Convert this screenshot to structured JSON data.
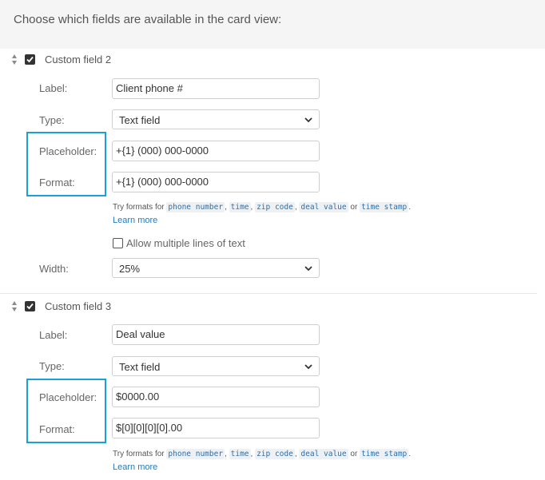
{
  "header": {
    "text": "Choose which fields are available in the card view:"
  },
  "fields": [
    {
      "title": "Custom field 2",
      "checked": true,
      "label_caption": "Label:",
      "label_value": "Client phone #",
      "type_caption": "Type:",
      "type_value": "Text field",
      "placeholder_caption": "Placeholder:",
      "placeholder_value": "+{1} (000) 000-0000",
      "format_caption": "Format:",
      "format_value": "+{1} (000) 000-0000",
      "hint": {
        "prefix": "Try formats for ",
        "formats": [
          "phone number",
          "time",
          "zip code",
          "deal value",
          "time stamp"
        ],
        "or": " or ",
        "suffix": ".",
        "learn_more": "Learn more"
      },
      "multiline_label": "Allow multiple lines of text",
      "multiline_checked": false,
      "width_caption": "Width:",
      "width_value": "25%"
    },
    {
      "title": "Custom field 3",
      "checked": true,
      "label_caption": "Label:",
      "label_value": "Deal value",
      "type_caption": "Type:",
      "type_value": "Text field",
      "placeholder_caption": "Placeholder:",
      "placeholder_value": "$0000.00",
      "format_caption": "Format:",
      "format_value": "$[0][0][0][0].00",
      "hint": {
        "prefix": "Try formats for ",
        "formats": [
          "phone number",
          "time",
          "zip code",
          "deal value",
          "time stamp"
        ],
        "or": " or ",
        "suffix": ".",
        "learn_more": "Learn more"
      }
    }
  ],
  "colors": {
    "highlight": "#1a9fd8",
    "link": "#2a7ab8",
    "code": "#2f6fa8"
  }
}
